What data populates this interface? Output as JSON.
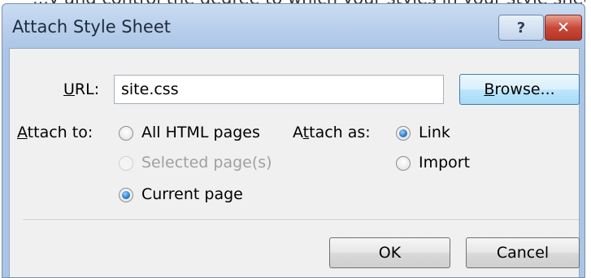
{
  "background_text": "...y and control the degree to which your styles in your style sheet affect...",
  "dialog": {
    "title": "Attach Style Sheet",
    "help_glyph": "?",
    "close_glyph": "✕",
    "help_icon": "help-icon",
    "close_icon": "close-icon"
  },
  "url": {
    "label_mnemonic": "U",
    "label_rest": "RL:",
    "value": "site.css"
  },
  "browse_button": {
    "mnemonic": "B",
    "rest": "rowse..."
  },
  "attach_to": {
    "label_mnemonic": "A",
    "label_rest": "ttach to:",
    "options": [
      {
        "label": "All HTML pages",
        "checked": false,
        "enabled": true
      },
      {
        "label": "Selected page(s)",
        "checked": false,
        "enabled": false
      },
      {
        "label": "Current page",
        "checked": true,
        "enabled": true
      }
    ]
  },
  "attach_as": {
    "label_pre": "A",
    "label_mnemonic": "t",
    "label_rest": "tach as:",
    "options": [
      {
        "label": "Link",
        "checked": true,
        "enabled": true
      },
      {
        "label": "Import",
        "checked": false,
        "enabled": true
      }
    ]
  },
  "footer": {
    "ok_label": "OK",
    "cancel_label": "Cancel"
  }
}
